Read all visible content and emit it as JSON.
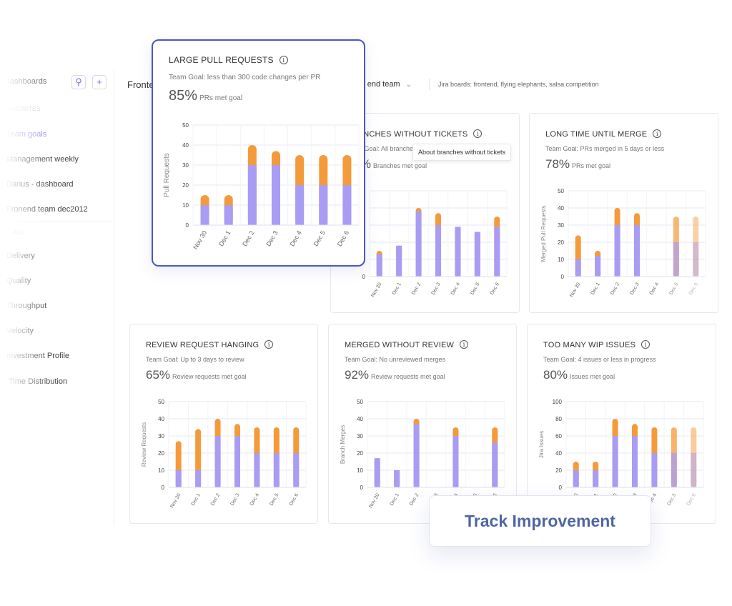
{
  "sidebar": {
    "title": "Dashboards",
    "search_icon": "search-icon",
    "add_icon": "plus-icon",
    "favorites_label": "FAVORITES",
    "favorites": [
      "Team goals",
      "Management weekly",
      "Darius - dashboard",
      "Fronend team dec2012"
    ],
    "all_label": "ALL",
    "all": [
      "Delivery",
      "Quality",
      "Throughput",
      "Velocity",
      "Investment Profile",
      "Time Distribution"
    ]
  },
  "header": {
    "title": "Frontend",
    "team": "Front end team",
    "jira": "Jira boards: frontend, flying elephants, salsa competition"
  },
  "tooltip": "About branches without tickets",
  "banner": "Track Improvement",
  "colors": {
    "met": "#a89cf5",
    "missed": "#f59a3a",
    "accent": "#4b56c9"
  },
  "cards": [
    {
      "title": "LARGE PULL REQUESTS",
      "goal": "Team Goal: less than 300 code changes per PR",
      "pct": "85%",
      "pct_label": "PRs met goal"
    },
    {
      "title": "BRANCHES WITHOUT TICKETS",
      "goal": "Team Goal: All branches linked to tickets",
      "pct": "80%",
      "pct_label": "Branches met goal"
    },
    {
      "title": "LONG TIME UNTIL MERGE",
      "goal": "Team Goal: PRs merged in 5 days or less",
      "pct": "78%",
      "pct_label": "PRs met goal"
    },
    {
      "title": "REVIEW REQUEST HANGING",
      "goal": "Team Goal: Up to 3 days to review",
      "pct": "65%",
      "pct_label": "Review requests met goal"
    },
    {
      "title": "MERGED WITHOUT REVIEW",
      "goal": "Team Goal: No unreviewed merges",
      "pct": "92%",
      "pct_label": "Review requests met goal"
    },
    {
      "title": "TOO MANY WIP ISSUES",
      "goal": "Team Goal: 4 issues or less in progress",
      "pct": "80%",
      "pct_label": "Issues met goal"
    }
  ],
  "chart_data": [
    {
      "type": "bar",
      "stacked": true,
      "ylabel": "Pull Requests",
      "ylim": [
        0,
        50
      ],
      "yticks": [
        0,
        10,
        20,
        30,
        40,
        50
      ],
      "categories": [
        "Nov 30",
        "Dec 1",
        "Dec 2",
        "Dec 3",
        "Dec 4",
        "Dec 5",
        "Dec 6"
      ],
      "series": [
        {
          "values": [
            10,
            10,
            30,
            30,
            20,
            20,
            20
          ]
        },
        {
          "values": [
            5,
            5,
            10,
            7,
            15,
            15,
            15
          ]
        }
      ],
      "opacity": [
        1,
        1,
        1,
        1,
        1,
        1,
        1
      ]
    },
    {
      "type": "bar",
      "stacked": true,
      "ylabel": "",
      "ylim": [
        0,
        50
      ],
      "yticks": [
        0,
        10,
        20,
        30,
        40,
        50
      ],
      "categories": [
        "Nov 30",
        "Dec 1",
        "Dec 2",
        "Dec 3",
        "Dec 4",
        "Dec 5",
        "Dec 6"
      ],
      "series": [
        {
          "values": [
            13,
            18,
            38,
            30,
            29,
            26,
            29
          ]
        },
        {
          "values": [
            2,
            0,
            2,
            7,
            0,
            0,
            6
          ]
        }
      ],
      "opacity": [
        1,
        1,
        1,
        1,
        1,
        1,
        1
      ]
    },
    {
      "type": "bar",
      "stacked": true,
      "ylabel": "Merged Pull Requests",
      "ylim": [
        0,
        50
      ],
      "yticks": [
        0,
        10,
        20,
        30,
        40,
        50
      ],
      "categories": [
        "Nov 30",
        "Dec 1",
        "Dec 2",
        "Dec 3",
        "Dec 4",
        "Dec 5",
        "Dec 6"
      ],
      "series": [
        {
          "values": [
            10,
            12,
            30,
            30,
            0,
            20,
            20
          ]
        },
        {
          "values": [
            14,
            3,
            10,
            7,
            0,
            15,
            15
          ]
        }
      ],
      "opacity": [
        1,
        1,
        1,
        1,
        1,
        0.7,
        0.45
      ]
    },
    {
      "type": "bar",
      "stacked": true,
      "ylabel": "Review Requests",
      "ylim": [
        0,
        50
      ],
      "yticks": [
        0,
        10,
        20,
        30,
        40,
        50
      ],
      "categories": [
        "Nov 30",
        "Dec 1",
        "Dec 2",
        "Dec 3",
        "Dec 4",
        "Dec 5",
        "Dec 6"
      ],
      "series": [
        {
          "values": [
            10,
            10,
            30,
            30,
            20,
            20,
            20
          ]
        },
        {
          "values": [
            17,
            24,
            10,
            7,
            15,
            15,
            15
          ]
        }
      ],
      "opacity": [
        1,
        1,
        1,
        1,
        1,
        1,
        1
      ]
    },
    {
      "type": "bar",
      "stacked": true,
      "ylabel": "Branch Merges",
      "ylim": [
        0,
        50
      ],
      "yticks": [
        0,
        10,
        20,
        30,
        40,
        50
      ],
      "categories": [
        "Nov 30",
        "Dec 1",
        "Dec 2",
        "Dec 3",
        "Dec 4",
        "Dec 5",
        "Dec 6"
      ],
      "series": [
        {
          "values": [
            17,
            10,
            37,
            0,
            30,
            0,
            26
          ]
        },
        {
          "values": [
            0,
            0,
            3,
            0,
            5,
            0,
            9
          ]
        }
      ],
      "opacity": [
        1,
        1,
        1,
        1,
        1,
        1,
        1
      ]
    },
    {
      "type": "bar",
      "stacked": true,
      "ylabel": "Jira Issues",
      "ylim": [
        0,
        100
      ],
      "yticks": [
        0,
        20,
        40,
        60,
        80,
        100
      ],
      "categories": [
        "Nov 30",
        "Dec 1",
        "Dec 2",
        "Dec 3",
        "Dec 4",
        "Dec 5",
        "Dec 6"
      ],
      "series": [
        {
          "values": [
            20,
            20,
            60,
            60,
            40,
            40,
            40
          ]
        },
        {
          "values": [
            10,
            10,
            20,
            14,
            30,
            30,
            30
          ]
        }
      ],
      "opacity": [
        1,
        1,
        1,
        1,
        1,
        0.75,
        0.5
      ]
    }
  ]
}
